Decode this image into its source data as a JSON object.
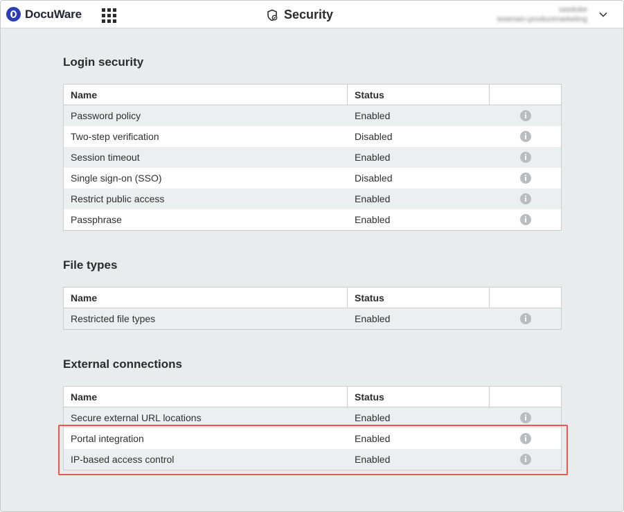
{
  "header": {
    "brand": "DocuWare",
    "page_title": "Security",
    "user_name": "sasduke",
    "user_org": "testmain-productmarketing"
  },
  "sections": {
    "login": {
      "title": "Login security",
      "col_name": "Name",
      "col_status": "Status",
      "rows": [
        {
          "name": "Password policy",
          "status": "Enabled"
        },
        {
          "name": "Two-step verification",
          "status": "Disabled"
        },
        {
          "name": "Session timeout",
          "status": "Enabled"
        },
        {
          "name": "Single sign-on (SSO)",
          "status": "Disabled"
        },
        {
          "name": "Restrict public access",
          "status": "Enabled"
        },
        {
          "name": "Passphrase",
          "status": "Enabled"
        }
      ]
    },
    "files": {
      "title": "File types",
      "col_name": "Name",
      "col_status": "Status",
      "rows": [
        {
          "name": "Restricted file types",
          "status": "Enabled"
        }
      ]
    },
    "external": {
      "title": "External connections",
      "col_name": "Name",
      "col_status": "Status",
      "rows": [
        {
          "name": "Secure external URL locations",
          "status": "Enabled"
        },
        {
          "name": "Portal integration",
          "status": "Enabled"
        },
        {
          "name": "IP-based access control",
          "status": "Enabled"
        }
      ]
    }
  },
  "colors": {
    "brand_blue": "#2b3fb4",
    "highlight_red": "#e8574f",
    "page_bg": "#e9eced"
  },
  "icons": {
    "apps": "apps-grid-icon",
    "security": "shield-icon",
    "expand": "chevron-down-icon",
    "info": "info-icon"
  }
}
